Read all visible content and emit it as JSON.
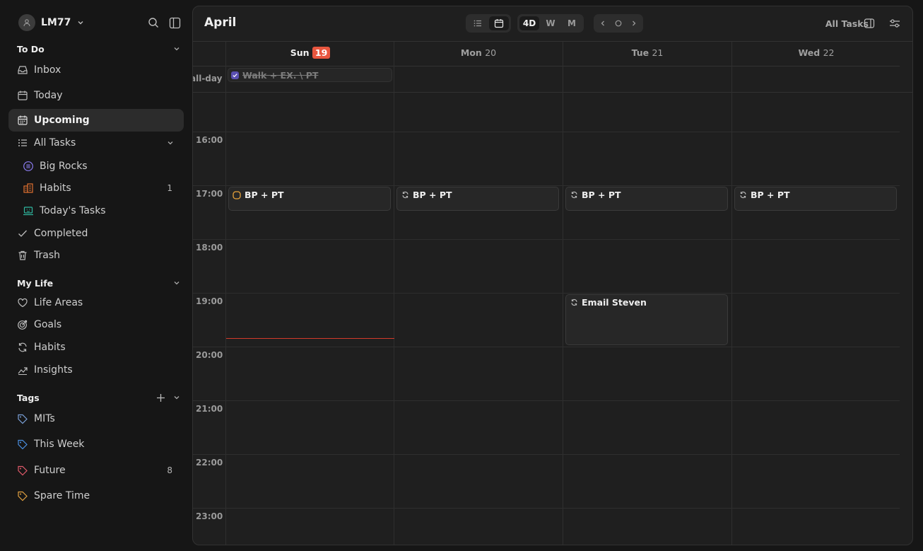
{
  "user": {
    "name": "LM77"
  },
  "sections": {
    "todo": "To Do",
    "mylife": "My Life",
    "tags": "Tags"
  },
  "nav": {
    "inbox": "Inbox",
    "today": "Today",
    "upcoming": "Upcoming",
    "all_tasks": "All Tasks",
    "big_rocks": "Big Rocks",
    "habits_list": "Habits",
    "habits_list_count": "1",
    "todays_tasks": "Today's Tasks",
    "completed": "Completed",
    "trash": "Trash",
    "life_areas": "Life Areas",
    "goals": "Goals",
    "habits": "Habits",
    "insights": "Insights"
  },
  "tags": [
    {
      "label": "MITs",
      "color": "#7a9fd6"
    },
    {
      "label": "This Week",
      "color": "#4a8fe0"
    },
    {
      "label": "Future",
      "color": "#e05a6a",
      "count": "8"
    },
    {
      "label": "Spare Time",
      "color": "#e0a040"
    }
  ],
  "calendar": {
    "month": "April",
    "view_buttons": {
      "four_day": "4D",
      "week": "W",
      "month": "M"
    },
    "active_view": "4D",
    "all_tasks_label": "All Tasks",
    "allday_label": "all-day",
    "days": [
      {
        "name": "Sun",
        "num": "19",
        "today": true
      },
      {
        "name": "Mon",
        "num": "20"
      },
      {
        "name": "Tue",
        "num": "21"
      },
      {
        "name": "Wed",
        "num": "22"
      }
    ],
    "allday_event": {
      "title": "Walk + EX. \\ PT",
      "done": true,
      "day": 0
    },
    "hours": [
      "16:00",
      "17:00",
      "18:00",
      "19:00",
      "20:00",
      "21:00",
      "22:00",
      "23:00"
    ],
    "events": [
      {
        "title": "BP + PT",
        "day": 0,
        "start": 17.0,
        "end": 17.5,
        "icon": "circle-checkbox-icon"
      },
      {
        "title": "BP + PT",
        "day": 1,
        "start": 17.0,
        "end": 17.5,
        "icon": "repeat-icon"
      },
      {
        "title": "BP + PT",
        "day": 2,
        "start": 17.0,
        "end": 17.5,
        "icon": "repeat-icon"
      },
      {
        "title": "BP + PT",
        "day": 3,
        "start": 17.0,
        "end": 17.5,
        "icon": "repeat-icon"
      },
      {
        "title": "Email Steven",
        "day": 2,
        "start": 19.0,
        "end": 20.0,
        "icon": "repeat-icon"
      }
    ],
    "now_time": 19.85,
    "accent": "#e8563f"
  }
}
